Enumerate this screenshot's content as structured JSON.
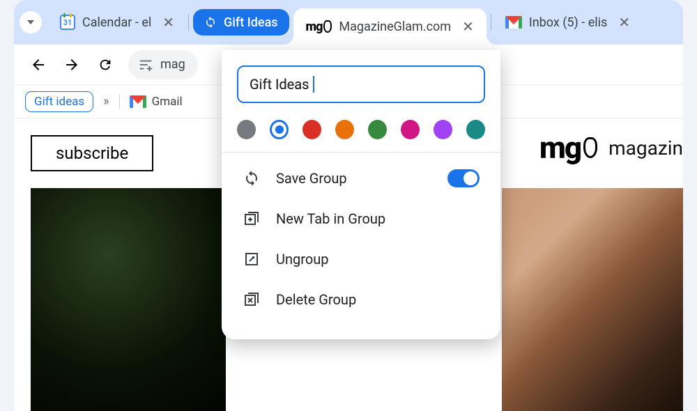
{
  "tabs": {
    "dropdown": true,
    "calendar": {
      "title": "Calendar - el",
      "day": "31"
    },
    "group_pill": {
      "label": "Gift Ideas"
    },
    "active": {
      "title": "MagazineGlam.com"
    },
    "gmail": {
      "title": "Inbox (5) - elis"
    }
  },
  "toolbar": {
    "url_fragment": "mag"
  },
  "bookmarks": {
    "chip": "Gift ideas",
    "gmail": "Gmail"
  },
  "page": {
    "subscribe": "subscribe",
    "brand_logo": "mg",
    "brand_text": "magazin"
  },
  "popup": {
    "name_value": "Gift Ideas",
    "colors": {
      "grey": "#767a7e",
      "blue": "#1a73e8",
      "red": "#d93025",
      "orange": "#e8710a",
      "green": "#378a3d",
      "pink": "#d01884",
      "purple": "#a142f4",
      "teal": "#1a8a87"
    },
    "selected_color": "blue",
    "menu": {
      "save": "Save Group",
      "save_on": true,
      "newtab": "New Tab in Group",
      "ungroup": "Ungroup",
      "delete": "Delete Group"
    }
  }
}
